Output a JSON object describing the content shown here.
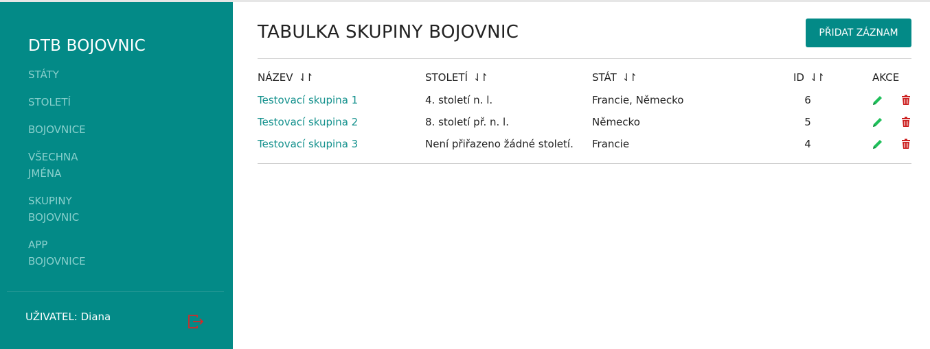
{
  "sidebar": {
    "brand": "DTB BOJOVNIC",
    "items": [
      {
        "label": "STÁTY"
      },
      {
        "label": "STOLETÍ"
      },
      {
        "label": "BOJOVNICE"
      },
      {
        "label": "VŠECHNA JMÉNA"
      },
      {
        "label": "SKUPINY BOJOVNIC"
      },
      {
        "label": "APP BOJOVNICE"
      }
    ],
    "user_label": "UŽIVATEL: Diana",
    "logout_icon": "logout-icon"
  },
  "main": {
    "title": "TABULKA SKUPINY BOJOVNIC",
    "add_button": "PŘIDAT ZÁZNAM",
    "columns": [
      {
        "label": "NÁZEV",
        "sortable": true
      },
      {
        "label": "STOLETÍ",
        "sortable": true
      },
      {
        "label": "STÁT",
        "sortable": true
      },
      {
        "label": "ID",
        "sortable": true
      },
      {
        "label": "AKCE",
        "sortable": false
      }
    ],
    "sort_icon": "⇃↾",
    "rows": [
      {
        "name": "Testovací skupina 1",
        "century": "4. století n. l.",
        "state": "Francie, Německo",
        "id": "6"
      },
      {
        "name": "Testovací skupina 2",
        "century": "8. století př. n. l.",
        "state": "Německo",
        "id": "5"
      },
      {
        "name": "Testovací skupina 3",
        "century": "Není přiřazeno žádné století.",
        "state": "Francie",
        "id": "4"
      }
    ]
  },
  "colors": {
    "sidebar_bg": "#038a87",
    "link": "#12908c",
    "edit_icon": "#1fbf5a",
    "delete_icon": "#cc1f1f"
  }
}
